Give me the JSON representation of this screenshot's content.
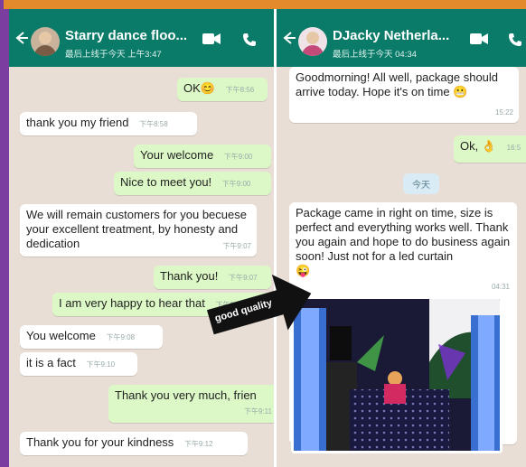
{
  "left_chat": {
    "contact_name": "Starry dance floo...",
    "status": "最后上线于今天 上午3:47",
    "messages": [
      {
        "dir": "out",
        "text": "OK",
        "emoji": "😊",
        "time": "下午8:56"
      },
      {
        "dir": "in",
        "text": "thank you my friend",
        "time": "下午8:58"
      },
      {
        "dir": "out",
        "text": "Your welcome",
        "time": "下午9:00"
      },
      {
        "dir": "out",
        "text": "Nice to meet you!",
        "time": "下午9:00"
      },
      {
        "dir": "in",
        "text": "We will remain customers for you becuese your excellent treatment, by honesty and dedication",
        "time": "下午9:07"
      },
      {
        "dir": "out",
        "text": "Thank you!",
        "time": "下午9:07"
      },
      {
        "dir": "out",
        "text": "I am very happy to hear that",
        "time": "下午9:07"
      },
      {
        "dir": "in",
        "text": "You welcome",
        "time": "下午9:08"
      },
      {
        "dir": "in",
        "text": "it is a fact",
        "time": "下午9:10"
      },
      {
        "dir": "out",
        "text": "Thank you very much, frien",
        "time": "下午9:11"
      },
      {
        "dir": "in",
        "text": "Thank you for your kindness",
        "time": "下午9:12"
      }
    ]
  },
  "right_chat": {
    "contact_name": "DJacky Netherla...",
    "status": "最后上线于今天 04:34",
    "date_chip": "今天",
    "messages": [
      {
        "dir": "in",
        "text": "Goodmorning! All well, package should arrive today. Hope it's on time",
        "emoji": "😬",
        "time": "15:22"
      },
      {
        "dir": "out",
        "text": "Ok,",
        "emoji": "👌",
        "time": "16:5"
      },
      {
        "dir": "in",
        "text": "Package came in right on time, size is perfect and everything works well. Thank you again and hope to do business again soon! Just not for a led curtain",
        "emoji": "😜",
        "time": "04:31"
      }
    ]
  },
  "overlay": {
    "sticker_text": "good quality"
  },
  "colors": {
    "header": "#0a7b68",
    "chat_bg": "#e8ded5",
    "outgoing": "#dcf8c6",
    "incoming": "#ffffff",
    "frame": "#6f2d8c",
    "accent": "#e38a2d"
  },
  "icons": [
    "back-arrow-icon",
    "video-call-icon",
    "phone-icon"
  ]
}
